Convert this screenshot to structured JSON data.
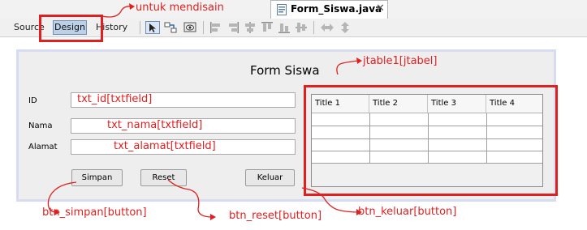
{
  "tabs": {
    "editor_tab_label": "Form_Siswa.java",
    "close_glyph": "✕"
  },
  "toolbar": {
    "source_label": "Source",
    "design_label": "Design",
    "history_label": "History"
  },
  "form": {
    "title": "Form Siswa",
    "labels": {
      "id": "ID",
      "nama": "Nama",
      "alamat": "Alamat"
    },
    "fields": {
      "id": "txt_id[txtfield]",
      "nama": "txt_nama[txtfield]",
      "alamat": "txt_alamat[txtfield]"
    },
    "buttons": {
      "simpan": "Simpan",
      "reset": "Reset",
      "keluar": "Keluar"
    },
    "table": {
      "columns": [
        "Title 1",
        "Title 2",
        "Title 3",
        "Title 4"
      ]
    }
  },
  "annotations": {
    "design": "untuk mendisain",
    "table": "jtable1[jtabel]",
    "simpan": "btn_simpan[button]",
    "reset": "btn_reset[button]",
    "keluar": "btn_keluar[button]"
  },
  "colors": {
    "annotation_red": "#e02020",
    "design_button_bg": "#bcd0e8",
    "canvas_bg": "#eeeeee"
  },
  "icons": [
    "java-file-icon",
    "selection-mode-icon",
    "connection-mode-icon",
    "preview-design-icon",
    "align-left-icon",
    "align-right-icon",
    "center-horizontally-icon",
    "align-top-icon",
    "align-bottom-icon",
    "center-vertically-icon",
    "horizontal-resize-icon",
    "vertical-resize-icon"
  ]
}
